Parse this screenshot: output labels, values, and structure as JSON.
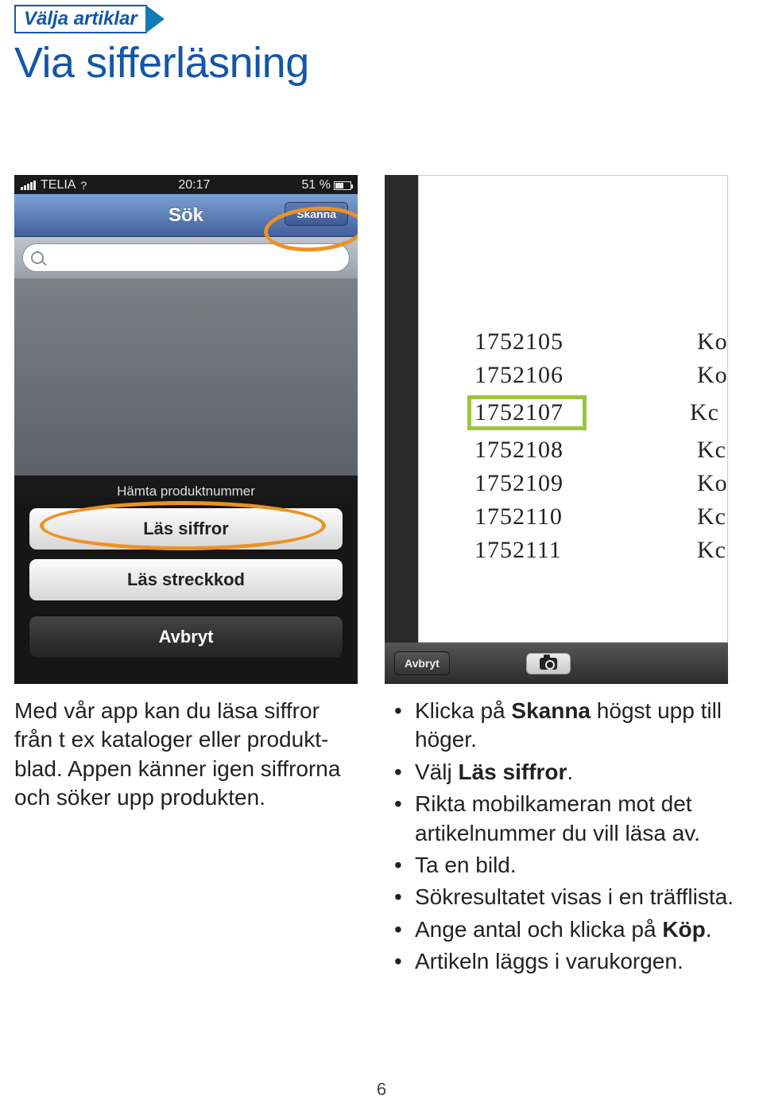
{
  "tag": "Välja artiklar",
  "heading": "Via sifferläsning",
  "phone1": {
    "status": {
      "carrier": "TELIA",
      "time": "20:17",
      "battery": "51 %"
    },
    "nav_title": "Sök",
    "skanna": "Skanna",
    "search_placeholder": "",
    "sheet_head": "Hämta produktnummer",
    "btn_read_digits": "Läs siffror",
    "btn_read_barcode": "Läs streckkod",
    "btn_cancel": "Avbryt"
  },
  "phone2": {
    "rows": [
      {
        "num": "1752105",
        "ko": "Ko"
      },
      {
        "num": "1752106",
        "ko": "Ko"
      },
      {
        "num": "1752107",
        "ko": "Kc",
        "highlight": true
      },
      {
        "num": "1752108",
        "ko": "Kc"
      },
      {
        "num": "1752109",
        "ko": "Ko"
      },
      {
        "num": "1752110",
        "ko": "Kc"
      },
      {
        "num": "1752111",
        "ko": "Kc"
      }
    ],
    "cancel": "Avbryt"
  },
  "intro": {
    "p1a": "Med vår app kan du läsa siffror från t ex kataloger eller produkt",
    "p1b": "blad. Appen känner igen siffrorna och söker upp produkten."
  },
  "bullets": {
    "b1a": "Klicka på ",
    "b1b": "Skanna",
    "b1c": " högst upp till höger.",
    "b2a": "Välj ",
    "b2b": "Läs siffror",
    "b2c": ".",
    "b3": "Rikta mobilkameran mot det artikelnummer du vill läsa av.",
    "b4": "Ta en bild.",
    "b5": "Sökresultatet visas i en träfflista.",
    "b6a": "Ange antal och klicka på ",
    "b6b": "Köp",
    "b6c": ".",
    "b7": "Artikeln läggs i varukorgen."
  },
  "page_number": "6"
}
